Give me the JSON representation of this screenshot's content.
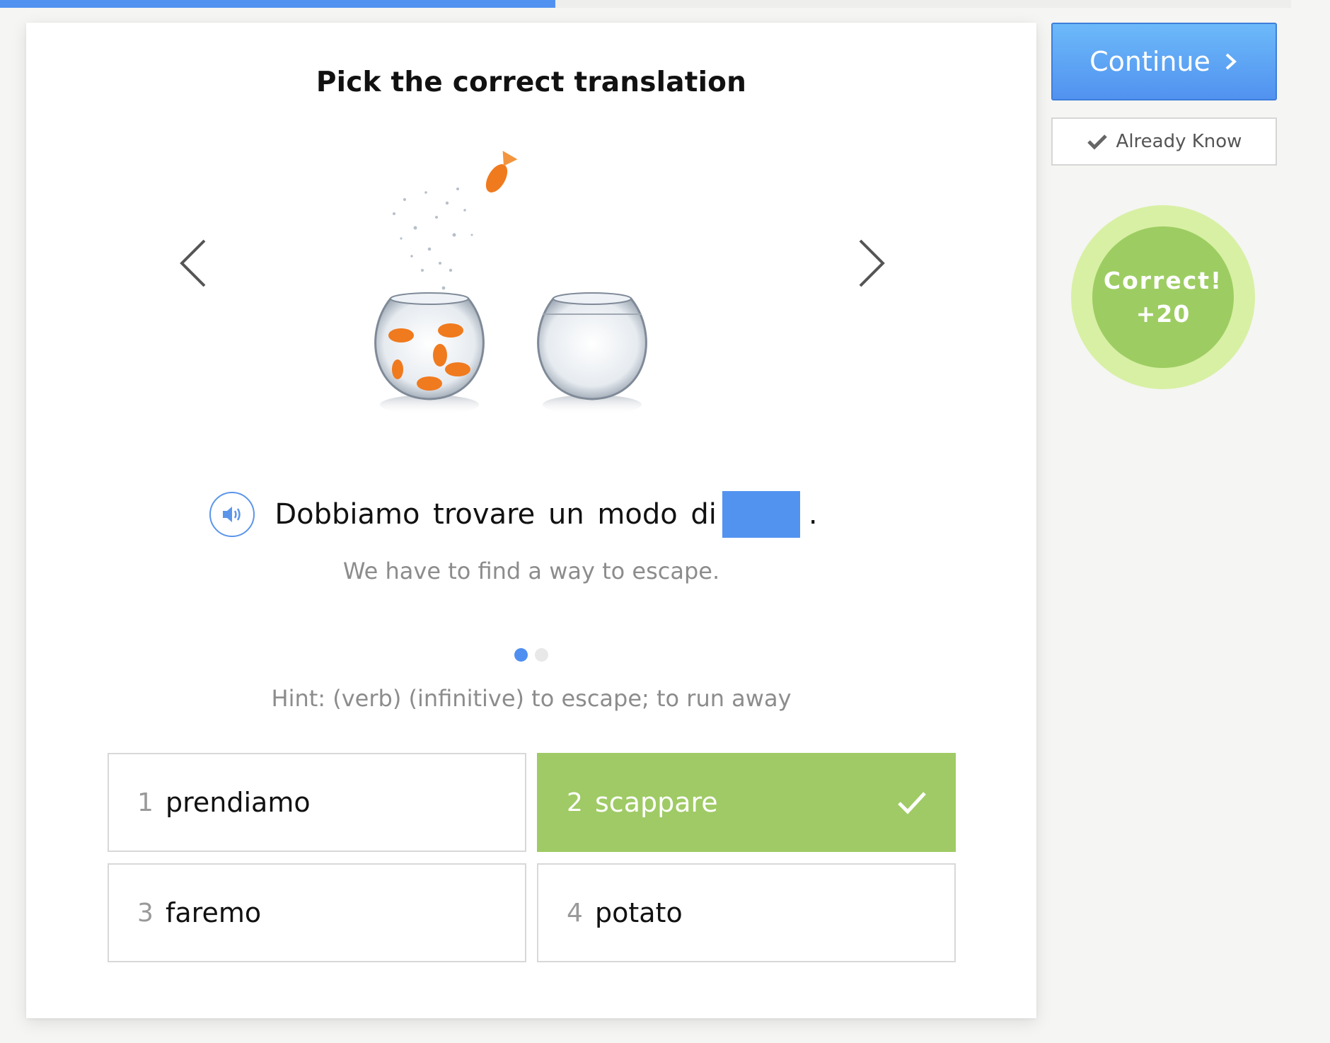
{
  "progress": {
    "value_percent": 43,
    "color": "#5192f0"
  },
  "exercise": {
    "title": "Pick the correct translation",
    "illustration": "fish-jumping-between-bowls-image",
    "sentence": "Dobbiamo trovare un modo di",
    "sentence_end": ".",
    "translation": "We have to find a way to escape.",
    "pager": {
      "total": 2,
      "active_index": 0
    },
    "hint": "Hint: (verb) (infinitive) to escape; to run away",
    "options": [
      {
        "number": "1",
        "word": "prendiamo",
        "state": "default"
      },
      {
        "number": "2",
        "word": "scappare",
        "state": "correct"
      },
      {
        "number": "3",
        "word": "faremo",
        "state": "default"
      },
      {
        "number": "4",
        "word": "potato",
        "state": "default"
      }
    ],
    "icons": {
      "prev": "chevron-left-icon",
      "next": "chevron-right-icon",
      "audio": "speaker-icon",
      "selected": "checkmark-icon"
    }
  },
  "sidebar": {
    "continue_label": "Continue",
    "already_know_label": "Already Know",
    "result": {
      "label": "Correct!",
      "points": "+20"
    }
  },
  "colors": {
    "accent_blue": "#5192f0",
    "correct_green": "#9fca65",
    "badge_outer": "#d8f0a4"
  }
}
